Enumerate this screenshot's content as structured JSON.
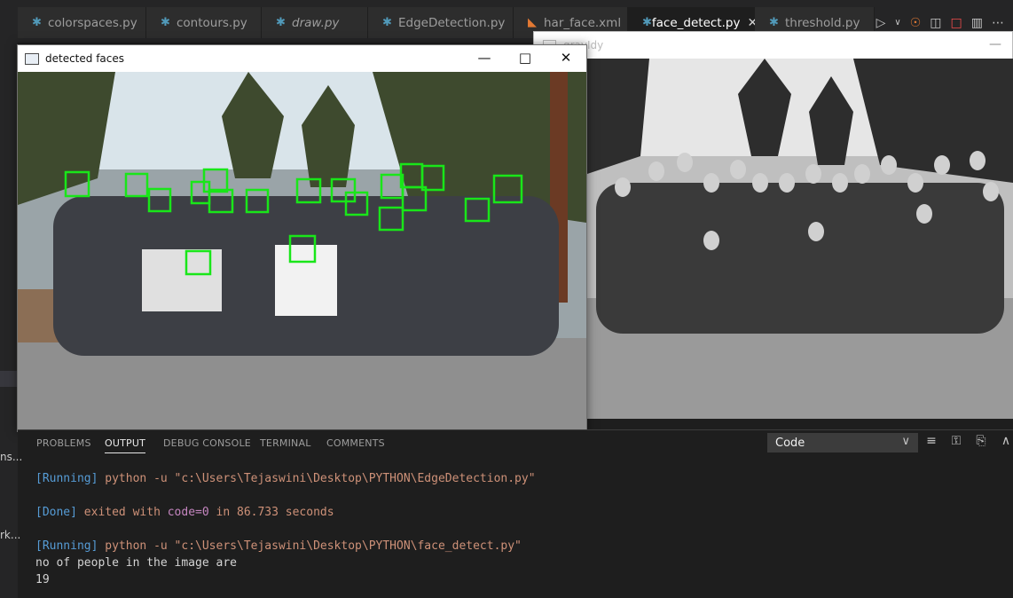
{
  "editor": {
    "tabs": [
      {
        "label": "colorspaces.py",
        "icon": "python-icon",
        "italic": false,
        "active": false
      },
      {
        "label": "contours.py",
        "icon": "python-icon",
        "italic": false,
        "active": false
      },
      {
        "label": "draw.py",
        "icon": "python-icon",
        "italic": true,
        "active": false
      },
      {
        "label": "EdgeDetection.py",
        "icon": "python-icon",
        "italic": false,
        "active": false
      },
      {
        "label": "har_face.xml",
        "icon": "rss-icon",
        "italic": false,
        "active": false
      },
      {
        "label": "face_detect.py",
        "icon": "python-icon",
        "italic": false,
        "active": true
      },
      {
        "label": "threshold.py",
        "icon": "python-icon",
        "italic": false,
        "active": false
      }
    ]
  },
  "windows": {
    "detected": {
      "title": "detected faces"
    },
    "gray": {
      "title": "grayIdy"
    }
  },
  "panel": {
    "tabs": [
      "PROBLEMS",
      "OUTPUT",
      "DEBUG CONSOLE",
      "TERMINAL",
      "COMMENTS"
    ],
    "active_tab": "OUTPUT",
    "output_channel": "Code"
  },
  "output": {
    "line1_tag": "[Running]",
    "line1_cmd": "python -u \"c:\\Users\\Tejaswini\\Desktop\\PYTHON\\EdgeDetection.py\"",
    "line2_tag": "[Done]",
    "line2_a": "exited with ",
    "line2_code": "code=0",
    "line2_b": " in 86.733 seconds",
    "line3_tag": "[Running]",
    "line3_cmd": "python -u \"c:\\Users\\Tejaswini\\Desktop\\PYTHON\\face_detect.py\"",
    "line4": "no of people in the image are",
    "line5": "19"
  },
  "sidebar_fragments": [
    "ns...",
    "rk..."
  ],
  "colors": {
    "face_box": "#19e619",
    "output_tag": "#569cd6",
    "output_text": "#ce9178",
    "code_purple": "#c586c0"
  }
}
